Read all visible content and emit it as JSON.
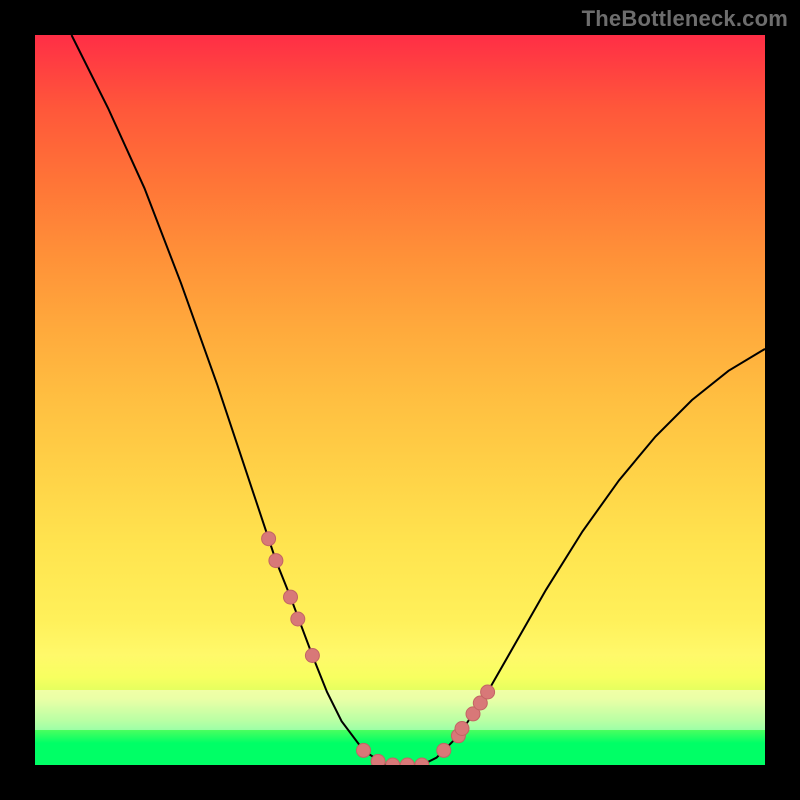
{
  "watermark": "TheBottleneck.com",
  "colors": {
    "curve": "#000000",
    "marker_fill": "#d87878",
    "marker_stroke": "#c26464",
    "pale_band": "rgba(255,255,255,0.45)"
  },
  "chart_data": {
    "type": "line",
    "title": "",
    "xlabel": "",
    "ylabel": "",
    "xlim": [
      0,
      100
    ],
    "ylim": [
      0,
      100
    ],
    "grid": false,
    "legend": false,
    "series": [
      {
        "name": "bottleneck-curve",
        "x": [
          5,
          10,
          15,
          20,
          25,
          28,
          30,
          33,
          35,
          38,
          40,
          42,
          45,
          48,
          50,
          53,
          55,
          58,
          62,
          66,
          70,
          75,
          80,
          85,
          90,
          95,
          100
        ],
        "y": [
          100,
          90,
          79,
          66,
          52,
          43,
          37,
          28,
          23,
          15,
          10,
          6,
          2,
          0,
          0,
          0,
          1,
          4,
          10,
          17,
          24,
          32,
          39,
          45,
          50,
          54,
          57
        ]
      }
    ],
    "markers": {
      "name": "highlight-points",
      "x": [
        32,
        33,
        35,
        36,
        38,
        45,
        47,
        49,
        51,
        53,
        56,
        58,
        58.5,
        60,
        61,
        62
      ],
      "y": [
        31,
        28,
        23,
        20,
        15,
        2,
        0.5,
        0,
        0,
        0,
        2,
        4,
        5,
        7,
        8.5,
        10
      ]
    }
  }
}
